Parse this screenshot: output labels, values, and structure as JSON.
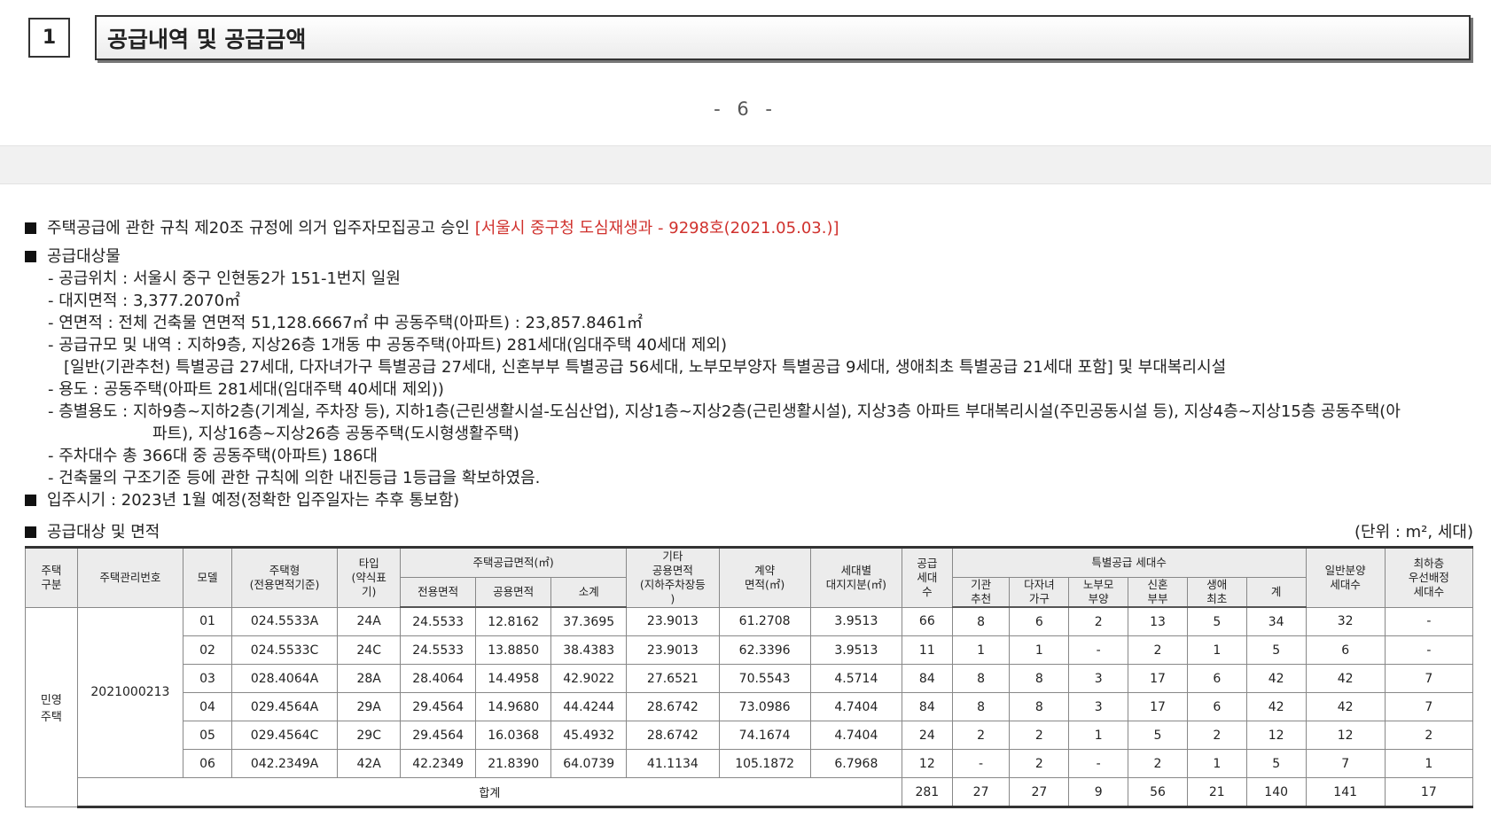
{
  "header": {
    "section_number": "1",
    "section_title": "공급내역 및 공급금액"
  },
  "page_number": "- 6 -",
  "notice": {
    "approval_text": "주택공급에 관한 규칙 제20조 규정에 의거 입주자모집공고 승인",
    "approval_ref": "[서울시 중구청 도심재생과 - 9298호(2021.05.03.)]"
  },
  "target": {
    "heading": "공급대상물",
    "location": "- 공급위치 : 서울시 중구 인현동2가 151-1번지 일원",
    "land_area": "- 대지면적 : 3,377.2070㎡",
    "floor_area": "- 연면적 : 전체 건축물 연면적 51,128.6667㎡ 中 공동주택(아파트) : 23,857.8461㎡",
    "scale_1": "- 공급규모 및 내역 : 지하9층, 지상26층 1개동 中 공동주택(아파트) 281세대(임대주택 40세대 제외)",
    "scale_2": "[일반(기관추천) 특별공급 27세대, 다자녀가구 특별공급 27세대, 신혼부부 특별공급 56세대, 노부모부양자 특별공급 9세대, 생애최초 특별공급 21세대 포함] 및 부대복리시설",
    "use": "- 용도 : 공동주택(아파트 281세대(임대주택 40세대 제외))",
    "floor_use_1": "- 층별용도 : 지하9층~지하2층(기계실, 주차장 등), 지하1층(근린생활시설-도심산업), 지상1층~지상2층(근린생활시설), 지상3층 아파트 부대복리시설(주민공동시설 등), 지상4층~지상15층 공동주택(아",
    "floor_use_2": "파트), 지상16층~지상26층 공동주택(도시형생활주택)",
    "parking": "- 주차대수 총 366대 중 공동주택(아파트) 186대",
    "seismic": "- 건축물의 구조기준 등에 관한 규칙에 의한 내진등급 1등급을 확보하였음."
  },
  "move_in": "입주시기 : 2023년 1월 예정(정확한 입주일자는 추후 통보함)",
  "table_section": {
    "heading": "공급대상 및 면적",
    "unit": "(단위 : m², 세대)"
  },
  "table": {
    "h_housing_type": "주택\n구분",
    "h_mgmt_no": "주택관리번호",
    "h_model": "모델",
    "h_house_type": "주택형\n(전용면적기준)",
    "h_type_abbr": "타입\n(약식표\n기)",
    "h_supply_area": "주택공급면적(㎡)",
    "h_exclusive": "전용면적",
    "h_common": "공용면적",
    "h_subtotal": "소계",
    "h_other_common": "기타\n공용면적\n(지하주차장등\n)",
    "h_contract_area": "계약\n면적(㎡)",
    "h_land_share": "세대별\n대지지분(㎡)",
    "h_supply_units": "공급\n세대\n수",
    "h_special": "특별공급 세대수",
    "h_inst": "기관\n추천",
    "h_multi": "다자녀\n가구",
    "h_elder": "노부모\n부양",
    "h_newlywed": "신혼\n부부",
    "h_first": "생애\n최초",
    "h_sum": "계",
    "h_general": "일반분양\n세대수",
    "h_lowest": "최하층\n우선배정\n세대수",
    "housing_type": "민영\n주택",
    "mgmt_no": "2021000213",
    "rows": [
      [
        "01",
        "024.5533A",
        "24A",
        "24.5533",
        "12.8162",
        "37.3695",
        "23.9013",
        "61.2708",
        "3.9513",
        "66",
        "8",
        "6",
        "2",
        "13",
        "5",
        "34",
        "32",
        "-"
      ],
      [
        "02",
        "024.5533C",
        "24C",
        "24.5533",
        "13.8850",
        "38.4383",
        "23.9013",
        "62.3396",
        "3.9513",
        "11",
        "1",
        "1",
        "-",
        "2",
        "1",
        "5",
        "6",
        "-"
      ],
      [
        "03",
        "028.4064A",
        "28A",
        "28.4064",
        "14.4958",
        "42.9022",
        "27.6521",
        "70.5543",
        "4.5714",
        "84",
        "8",
        "8",
        "3",
        "17",
        "6",
        "42",
        "42",
        "7"
      ],
      [
        "04",
        "029.4564A",
        "29A",
        "29.4564",
        "14.9680",
        "44.4244",
        "28.6742",
        "73.0986",
        "4.7404",
        "84",
        "8",
        "8",
        "3",
        "17",
        "6",
        "42",
        "42",
        "7"
      ],
      [
        "05",
        "029.4564C",
        "29C",
        "29.4564",
        "16.0368",
        "45.4932",
        "28.6742",
        "74.1674",
        "4.7404",
        "24",
        "2",
        "2",
        "1",
        "5",
        "2",
        "12",
        "12",
        "2"
      ],
      [
        "06",
        "042.2349A",
        "42A",
        "42.2349",
        "21.8390",
        "64.0739",
        "41.1134",
        "105.1872",
        "6.7968",
        "12",
        "-",
        "2",
        "-",
        "2",
        "1",
        "5",
        "7",
        "1"
      ]
    ],
    "total_label": "합계",
    "totals": [
      "281",
      "27",
      "27",
      "9",
      "56",
      "21",
      "140",
      "141",
      "17"
    ]
  }
}
